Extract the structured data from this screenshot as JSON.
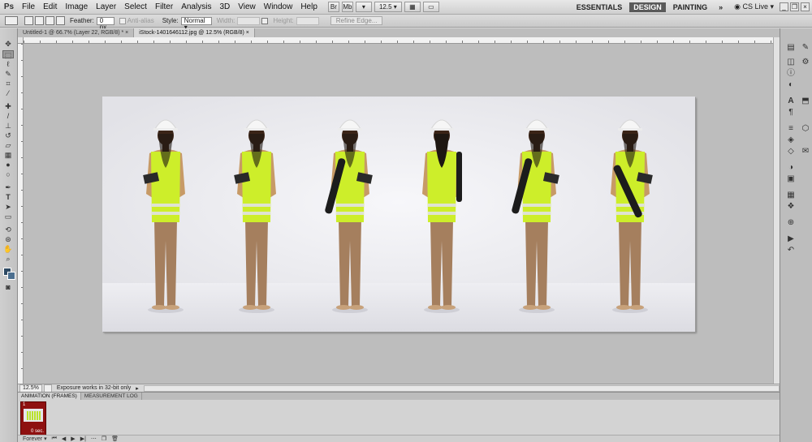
{
  "app": {
    "logo": "Ps"
  },
  "menu": [
    "File",
    "Edit",
    "Image",
    "Layer",
    "Select",
    "Filter",
    "Analysis",
    "3D",
    "View",
    "Window",
    "Help"
  ],
  "menubar": {
    "zoom_value": "12.5",
    "workspaces": [
      "ESSENTIALS",
      "DESIGN",
      "PAINTING"
    ],
    "active_workspace": "DESIGN",
    "more": "»",
    "cs_live": "CS Live"
  },
  "options": {
    "feather_label": "Feather:",
    "feather_value": "0 px",
    "anti_alias_label": "Anti-alias",
    "style_label": "Style:",
    "style_value": "Normal",
    "width_label": "Width:",
    "height_label": "Height:",
    "refine_edge": "Refine Edge..."
  },
  "tabs": [
    {
      "label": "Untitled-1 @ 66.7% (Layer 22, RGB/8) * ×",
      "active": false
    },
    {
      "label": "iStock-1401646112.jpg @ 12.5% (RGB/8) ×",
      "active": true
    }
  ],
  "status": {
    "zoom": "12.5%",
    "info": "Exposure works in 32-bit only"
  },
  "animation": {
    "tabs": [
      "ANIMATION (FRAMES)",
      "MEASUREMENT LOG"
    ],
    "frame_number": "1",
    "frame_time": "0 sec.",
    "loop": "Forever"
  },
  "colors": {
    "vest": "#cdee2a",
    "shirt": "#c79a66",
    "pants": "#a57f5e",
    "helmet": "#f6f6f6",
    "skin": "#3b2417",
    "workspace_active_bg": "#5a5a5a"
  },
  "icons": {
    "toolbox": [
      "move-icon",
      "marquee-icon",
      "lasso-icon",
      "quick-select-icon",
      "crop-icon",
      "eyedropper-icon",
      "healing-icon",
      "brush-icon",
      "clone-stamp-icon",
      "history-brush-icon",
      "eraser-icon",
      "gradient-icon",
      "blur-icon",
      "dodge-icon",
      "pen-icon",
      "type-icon",
      "path-select-icon",
      "shape-icon",
      "3d-rotate-icon",
      "3d-orbit-icon",
      "hand-icon",
      "zoom-icon"
    ],
    "dock": [
      "histogram-icon",
      "navigator-icon",
      "info-icon",
      "color-icon",
      "swatches-icon",
      "styles-icon",
      "character-icon",
      "paragraph-icon",
      "layers-icon",
      "channels-icon",
      "paths-icon",
      "adjustments-icon",
      "masks-icon",
      "brushes-icon",
      "clone-source-icon",
      "tool-presets-icon",
      "actions-icon",
      "history-icon"
    ]
  }
}
